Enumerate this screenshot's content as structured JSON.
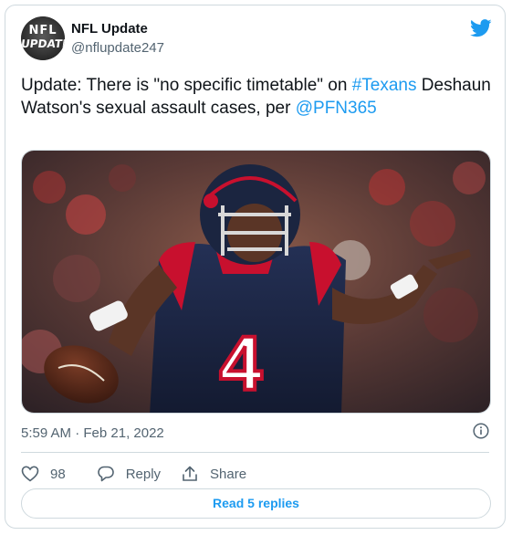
{
  "author": {
    "display_name": "NFL Update",
    "handle": "@nflupdate247",
    "avatar_line1": "NFL",
    "avatar_line2": "UPDATE"
  },
  "tweet": {
    "text_part1": "Update: There is \"no specific timetable\" on ",
    "hashtag": "#Texans",
    "text_part2": " Deshaun Watson's sexual assault cases, per ",
    "mention": "@PFN365",
    "jersey_number": "4"
  },
  "meta": {
    "timestamp": "5:59 AM · Feb 21, 2022"
  },
  "actions": {
    "like_count": "98",
    "reply_label": "Reply",
    "share_label": "Share"
  },
  "replies_button": "Read 5 replies",
  "colors": {
    "accent": "#1d9bf0",
    "text": "#0f1419",
    "muted": "#536471",
    "border": "#cfd9de",
    "jersey": "#1b2540",
    "jersey_red": "#c8102e"
  },
  "icons": [
    "twitter-bird-icon",
    "info-icon",
    "heart-icon",
    "reply-bubble-icon",
    "share-icon"
  ]
}
